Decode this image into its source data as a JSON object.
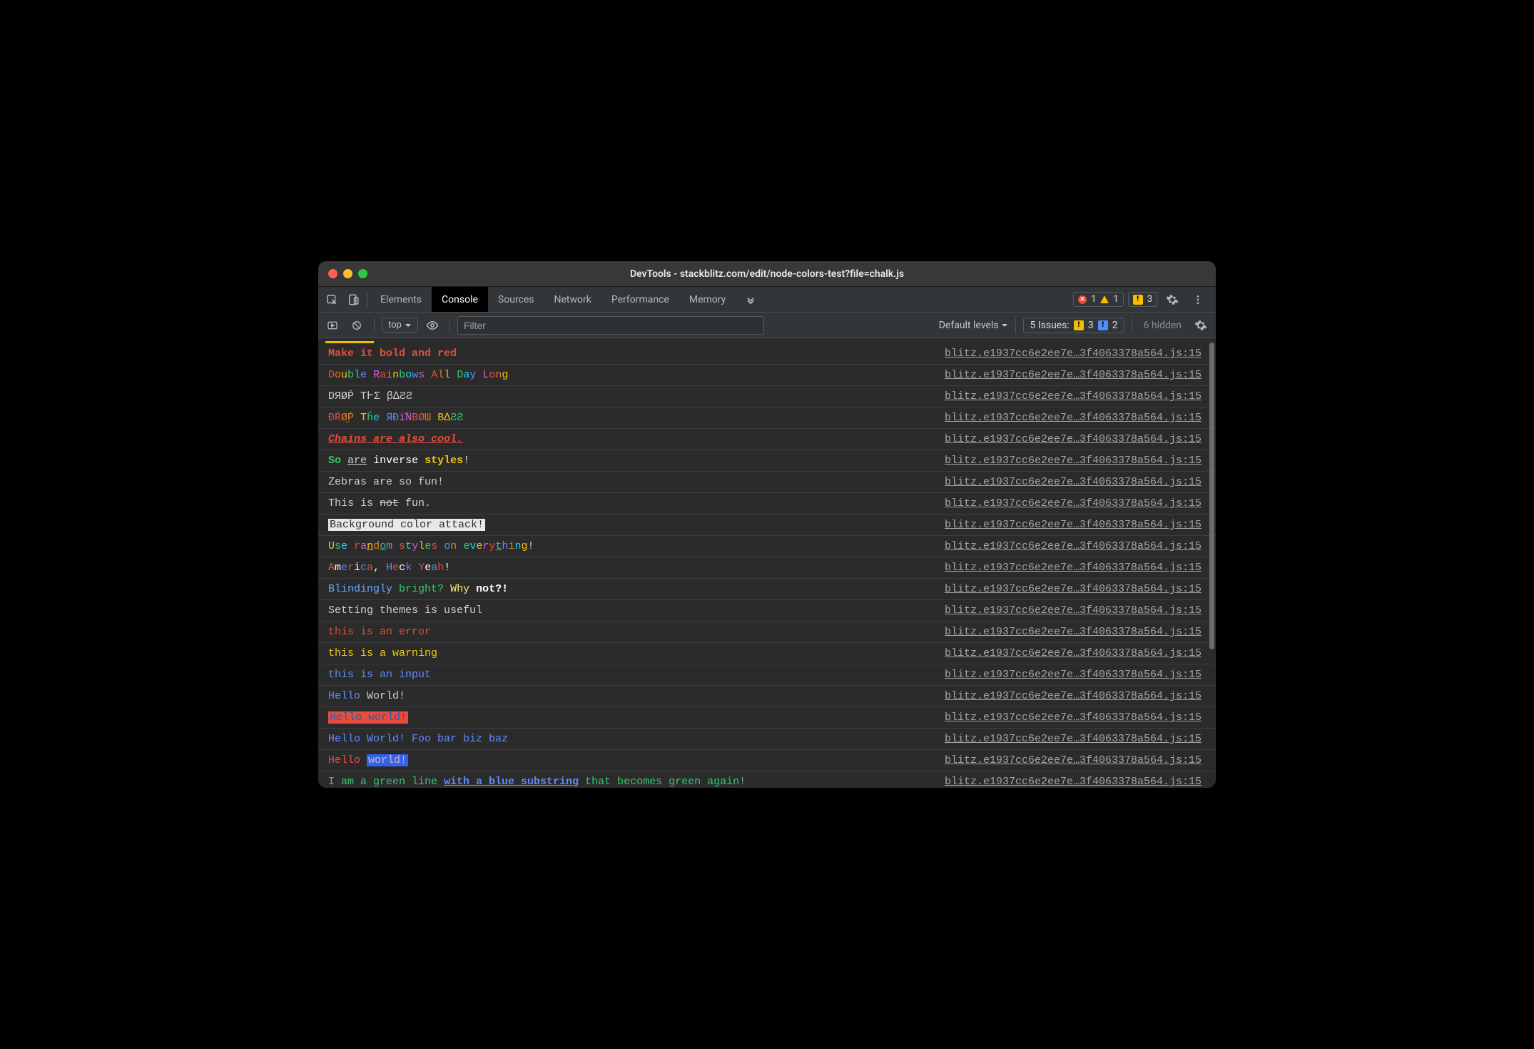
{
  "titlebar": {
    "title": "DevTools - stackblitz.com/edit/node-colors-test?file=chalk.js"
  },
  "tabs": {
    "items": [
      "Elements",
      "Console",
      "Sources",
      "Network",
      "Performance",
      "Memory"
    ],
    "active": "Console"
  },
  "counters": {
    "errors": "1",
    "warnings": "1",
    "issues": "3"
  },
  "filterbar": {
    "context": "top",
    "filter_placeholder": "Filter",
    "levels": "Default levels",
    "issues_label": "5 Issues:",
    "issues_yellow": "3",
    "issues_blue": "2",
    "hidden": "6 hidden"
  },
  "source_link": "blitz.e1937cc6e2ee7e…3f4063378a564.js:15",
  "rows": [
    {
      "type": "tokens",
      "tokens": [
        {
          "t": "Make it bold and red",
          "cls": "bold c-red"
        }
      ]
    },
    {
      "type": "tokens",
      "tokens": [
        {
          "t": "D",
          "cls": "c-red"
        },
        {
          "t": "o",
          "cls": "c-orange"
        },
        {
          "t": "u",
          "cls": "c-yellow"
        },
        {
          "t": "b",
          "cls": "c-green"
        },
        {
          "t": "l",
          "cls": "c-cyan"
        },
        {
          "t": "e",
          "cls": "c-blue"
        },
        {
          "t": " ",
          "cls": ""
        },
        {
          "t": "R",
          "cls": "c-magenta"
        },
        {
          "t": "a",
          "cls": "c-red"
        },
        {
          "t": "i",
          "cls": "c-orange"
        },
        {
          "t": "n",
          "cls": "c-yellow"
        },
        {
          "t": "b",
          "cls": "c-green"
        },
        {
          "t": "o",
          "cls": "c-cyan"
        },
        {
          "t": "w",
          "cls": "c-blue"
        },
        {
          "t": "s",
          "cls": "c-magenta"
        },
        {
          "t": " ",
          "cls": ""
        },
        {
          "t": "A",
          "cls": "c-red"
        },
        {
          "t": "l",
          "cls": "c-orange"
        },
        {
          "t": "l",
          "cls": "c-yellow"
        },
        {
          "t": " ",
          "cls": ""
        },
        {
          "t": "D",
          "cls": "c-green"
        },
        {
          "t": "a",
          "cls": "c-cyan"
        },
        {
          "t": "y",
          "cls": "c-blue"
        },
        {
          "t": " ",
          "cls": ""
        },
        {
          "t": "L",
          "cls": "c-magenta"
        },
        {
          "t": "o",
          "cls": "c-red"
        },
        {
          "t": "n",
          "cls": "c-orange"
        },
        {
          "t": "g",
          "cls": "c-yellow"
        }
      ]
    },
    {
      "type": "plain",
      "text": "DЯØṔ TͰΣ β∆ƧƧ",
      "cls": "c-gray"
    },
    {
      "type": "tokens",
      "tokens": [
        {
          "t": "ÐŔ",
          "cls": "c-red"
        },
        {
          "t": "Ø̤Ṗ",
          "cls": "c-orange"
        },
        {
          "t": " ",
          "cls": ""
        },
        {
          "t": "T",
          "cls": "c-yellow"
        },
        {
          "t": "ĥ",
          "cls": "c-green"
        },
        {
          "t": "e",
          "cls": "c-cyan"
        },
        {
          "t": " ",
          "cls": ""
        },
        {
          "t": "ЯÐ",
          "cls": "c-blue"
        },
        {
          "t": "i̎N̈",
          "cls": "c-magenta"
        },
        {
          "t": "BØ",
          "cls": "c-red"
        },
        {
          "t": "Ш",
          "cls": "c-orange"
        },
        {
          "t": " ",
          "cls": ""
        },
        {
          "t": "B∆",
          "cls": "c-yellow"
        },
        {
          "t": "ƧƧ",
          "cls": "c-green"
        }
      ]
    },
    {
      "type": "plain",
      "text": "Chains are also cool.",
      "cls": "bold ul it c-red"
    },
    {
      "type": "tokens",
      "tokens": [
        {
          "t": "So",
          "cls": "c-green bold"
        },
        {
          "t": " ",
          "cls": ""
        },
        {
          "t": "are",
          "cls": "ul c-gray"
        },
        {
          "t": " ",
          "cls": ""
        },
        {
          "t": "inverse",
          "cls": "c-white"
        },
        {
          "t": " ",
          "cls": ""
        },
        {
          "t": "styles",
          "cls": "bold c-yellow"
        },
        {
          "t": "!",
          "cls": "c-gray"
        }
      ]
    },
    {
      "type": "plain",
      "text": "Zebras are so fun!",
      "cls": "c-gray"
    },
    {
      "type": "tokens",
      "tokens": [
        {
          "t": "This is ",
          "cls": "c-gray"
        },
        {
          "t": "not",
          "cls": "st c-gray"
        },
        {
          "t": " fun.",
          "cls": "c-gray"
        }
      ]
    },
    {
      "type": "plain",
      "text": "Background color attack!",
      "cls": "bg-white"
    },
    {
      "type": "tokens",
      "tokens": [
        {
          "t": "U",
          "cls": "c-yellow"
        },
        {
          "t": "s",
          "cls": "c-green"
        },
        {
          "t": "e",
          "cls": "c-cyan"
        },
        {
          "t": " ",
          "cls": ""
        },
        {
          "t": "r",
          "cls": "c-red"
        },
        {
          "t": "a",
          "cls": "c-magenta"
        },
        {
          "t": "n",
          "cls": "ul c-yellow"
        },
        {
          "t": "d",
          "cls": "c-orange"
        },
        {
          "t": "o",
          "cls": "ul c-green"
        },
        {
          "t": "m",
          "cls": "c-blue"
        },
        {
          "t": " ",
          "cls": ""
        },
        {
          "t": "s",
          "cls": "c-red"
        },
        {
          "t": "t",
          "cls": "c-cyan"
        },
        {
          "t": "y",
          "cls": "c-magenta"
        },
        {
          "t": "l",
          "cls": "c-yellow"
        },
        {
          "t": "e",
          "cls": "c-green"
        },
        {
          "t": "s",
          "cls": "c-red"
        },
        {
          "t": " ",
          "cls": ""
        },
        {
          "t": "o",
          "cls": "c-blue"
        },
        {
          "t": "n",
          "cls": "c-orange"
        },
        {
          "t": " ",
          "cls": ""
        },
        {
          "t": "e",
          "cls": "c-green"
        },
        {
          "t": "v",
          "cls": "c-cyan"
        },
        {
          "t": "e",
          "cls": "c-yellow"
        },
        {
          "t": "r",
          "cls": "c-magenta"
        },
        {
          "t": "y",
          "cls": "c-red"
        },
        {
          "t": "t",
          "cls": "ul c-green"
        },
        {
          "t": "h",
          "cls": "c-blue"
        },
        {
          "t": "i",
          "cls": "c-orange"
        },
        {
          "t": "n",
          "cls": "c-cyan"
        },
        {
          "t": "g",
          "cls": "c-yellow"
        },
        {
          "t": "!",
          "cls": "c-gray"
        }
      ]
    },
    {
      "type": "tokens",
      "tokens": [
        {
          "t": "A",
          "cls": "c-red"
        },
        {
          "t": "m",
          "cls": "c-white"
        },
        {
          "t": "e",
          "cls": "c-blue"
        },
        {
          "t": "r",
          "cls": "c-red"
        },
        {
          "t": "i",
          "cls": "c-white"
        },
        {
          "t": "c",
          "cls": "c-blue"
        },
        {
          "t": "a",
          "cls": "c-red"
        },
        {
          "t": ",",
          "cls": "c-white"
        },
        {
          "t": " ",
          "cls": ""
        },
        {
          "t": "H",
          "cls": "c-blue"
        },
        {
          "t": "e",
          "cls": "c-red"
        },
        {
          "t": "c",
          "cls": "c-white"
        },
        {
          "t": "k",
          "cls": "c-blue"
        },
        {
          "t": " ",
          "cls": ""
        },
        {
          "t": "Y",
          "cls": "c-red"
        },
        {
          "t": "e",
          "cls": "c-white"
        },
        {
          "t": "a",
          "cls": "c-blue"
        },
        {
          "t": "h",
          "cls": "c-red"
        },
        {
          "t": "!",
          "cls": "c-white"
        }
      ]
    },
    {
      "type": "tokens",
      "tokens": [
        {
          "t": "Blindingly",
          "cls": "c-brblue"
        },
        {
          "t": " ",
          "cls": ""
        },
        {
          "t": "bright?",
          "cls": "c-green"
        },
        {
          "t": " ",
          "cls": ""
        },
        {
          "t": "Why",
          "cls": "c-bryellow"
        },
        {
          "t": " ",
          "cls": ""
        },
        {
          "t": "not?!",
          "cls": "c-white bold"
        }
      ]
    },
    {
      "type": "plain",
      "text": "Setting themes is useful",
      "cls": "c-gray"
    },
    {
      "type": "plain",
      "text": "this is an error",
      "cls": "c-red"
    },
    {
      "type": "plain",
      "text": "this is a warning",
      "cls": "c-yellow"
    },
    {
      "type": "plain",
      "text": "this is an input",
      "cls": "c-blue"
    },
    {
      "type": "tokens",
      "tokens": [
        {
          "t": "Hello",
          "cls": "c-blue"
        },
        {
          "t": " World!",
          "cls": "c-gray"
        }
      ]
    },
    {
      "type": "plain",
      "text": "Hello world!",
      "cls": "bg-red"
    },
    {
      "type": "tokens",
      "tokens": [
        {
          "t": "Hello World!",
          "cls": "c-blue"
        },
        {
          "t": " Foo bar biz baz",
          "cls": "c-blue"
        }
      ]
    },
    {
      "type": "tokens",
      "tokens": [
        {
          "t": "Hello ",
          "cls": "c-red"
        },
        {
          "t": "world!",
          "cls": "bg-blue"
        }
      ]
    },
    {
      "type": "tokens",
      "tokens": [
        {
          "t": "I am a green line ",
          "cls": "c-green"
        },
        {
          "t": "with a blue substring",
          "cls": "bold ul c-blue"
        },
        {
          "t": " that becomes green again!",
          "cls": "c-green"
        }
      ]
    },
    {
      "type": "srconly"
    }
  ]
}
